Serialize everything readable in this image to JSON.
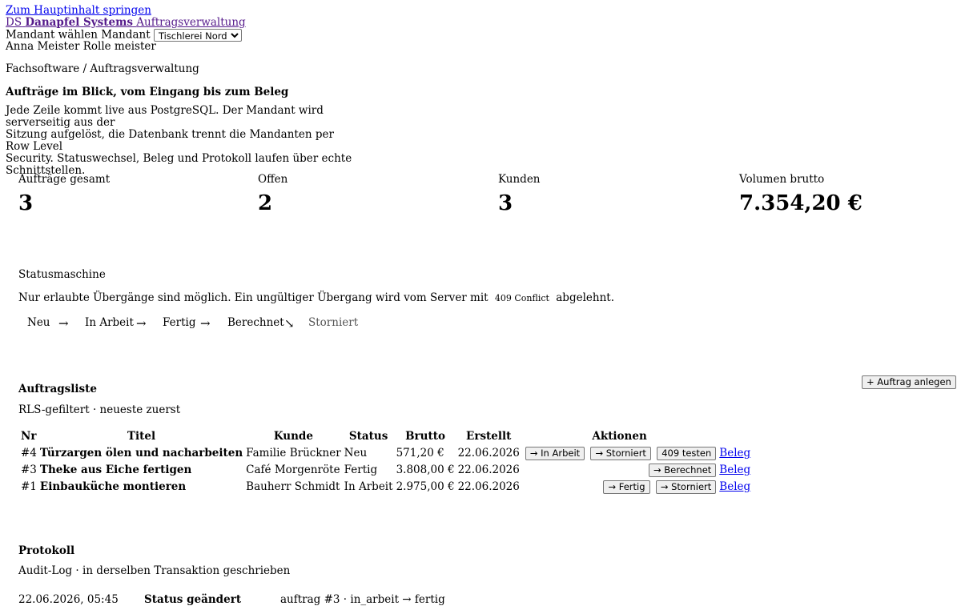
{
  "nav": {
    "skip_link": "Zum Hauptinhalt springen",
    "brand_abbr": "DS",
    "brand_name": "Danapfel Systems",
    "brand_product": "Auftragsverwaltung",
    "tenant_label": "Mandant wählen",
    "tenant_short": "Mandant",
    "tenant_selected": "Tischlerei Nord",
    "user_name": "Anna Meister",
    "role_label": "Rolle",
    "role_value": "meister"
  },
  "hero": {
    "breadcrumb": "Fachsoftware / Auftragsverwaltung",
    "title": "Aufträge im Blick, vom Eingang bis zum Beleg",
    "intro_line1": "Jede Zeile kommt live aus PostgreSQL. Der Mandant wird serverseitig aus der",
    "intro_line2": "Sitzung aufgelöst, die Datenbank trennt die Mandanten per Row Level",
    "intro_line3": "Security. Statuswechsel, Beleg und Protokoll laufen über echte Schnittstellen."
  },
  "kpis": [
    {
      "label": "Aufträge gesamt",
      "value": "3"
    },
    {
      "label": "Offen",
      "value": "2"
    },
    {
      "label": "Kunden",
      "value": "3"
    },
    {
      "label": "Volumen brutto",
      "value": "7.354,20 €"
    }
  ],
  "statemachine": {
    "heading": "Statusmaschine",
    "desc_before": "Nur erlaubte Übergänge sind möglich. Ein ungültiger Übergang wird vom Server mit",
    "desc_code": "409 Conflict",
    "desc_after": "abgelehnt.",
    "states": [
      "Neu",
      "In Arbeit",
      "Fertig",
      "Berechnet",
      "Storniert"
    ],
    "arrows": [
      "→",
      "→",
      "→",
      "↘"
    ]
  },
  "orders": {
    "heading": "Auftragsliste",
    "subtitle": "RLS-gefiltert · neueste zuerst",
    "add_button": "+ Auftrag anlegen",
    "columns": [
      "Nr",
      "Titel",
      "Kunde",
      "Status",
      "Brutto",
      "Erstellt",
      "Aktionen"
    ],
    "rows": [
      {
        "nr": "#4",
        "title": "Türzargen ölen und nacharbeiten",
        "customer": "Familie Brückner",
        "status": "Neu",
        "gross": "571,20 €",
        "created": "22.06.2026",
        "actions": [
          "→ In Arbeit",
          "→ Storniert",
          "409 testen"
        ],
        "receipt": "Beleg"
      },
      {
        "nr": "#3",
        "title": "Theke aus Eiche fertigen",
        "customer": "Café Morgenröte",
        "status": "Fertig",
        "gross": "3.808,00 €",
        "created": "22.06.2026",
        "actions": [
          "→ Berechnet"
        ],
        "receipt": "Beleg"
      },
      {
        "nr": "#1",
        "title": "Einbauküche montieren",
        "customer": "Bauherr Schmidt",
        "status": "In Arbeit",
        "gross": "2.975,00 €",
        "created": "22.06.2026",
        "actions": [
          "→ Fertig",
          "→ Storniert"
        ],
        "receipt": "Beleg"
      }
    ]
  },
  "protocol": {
    "heading": "Protokoll",
    "subtitle": "Audit-Log · in derselben Transaktion geschrieben",
    "entries": [
      {
        "time": "22.06.2026, 05:45",
        "event": "Status geändert",
        "detail": "auftrag #3 · in_arbeit → fertig"
      }
    ]
  }
}
